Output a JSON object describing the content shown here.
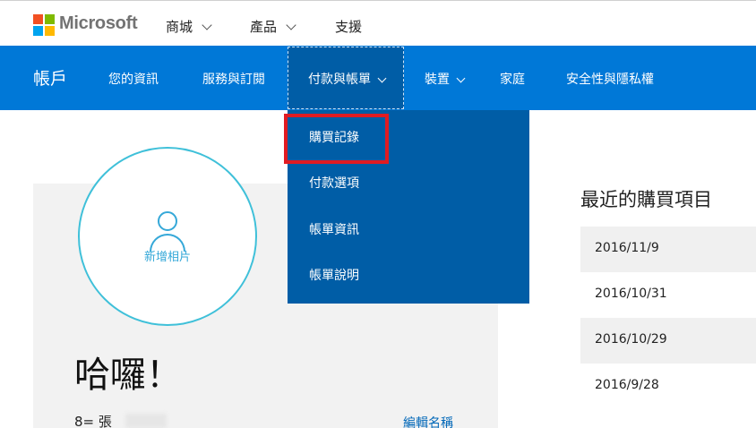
{
  "header": {
    "brand": "Microsoft",
    "nav": [
      {
        "label": "商城",
        "has_dropdown": true
      },
      {
        "label": "產品",
        "has_dropdown": true
      },
      {
        "label": "支援",
        "has_dropdown": false
      }
    ]
  },
  "account_nav": {
    "title": "帳戶",
    "items": [
      {
        "label": "您的資訊"
      },
      {
        "label": "服務與訂閱"
      },
      {
        "label": "付款與帳單",
        "active": true,
        "has_dropdown": true
      },
      {
        "label": "裝置",
        "has_dropdown": true
      },
      {
        "label": "家庭"
      },
      {
        "label": "安全性與隱私權"
      }
    ]
  },
  "dropdown": {
    "items": [
      {
        "label": "購買記錄",
        "highlighted": true
      },
      {
        "label": "付款選項"
      },
      {
        "label": "帳單資訊"
      },
      {
        "label": "帳單說明"
      }
    ]
  },
  "profile": {
    "add_photo": "新增相片",
    "greeting": "哈囉！",
    "name_prefix": "8= 張",
    "edit_name": "編輯名稱"
  },
  "recent": {
    "title": "最近的購買項目",
    "dates": [
      "2016/11/9",
      "2016/10/31",
      "2016/10/29",
      "2016/9/28"
    ]
  },
  "colors": {
    "accent_blue": "#0078d7",
    "dropdown_blue": "#005da6",
    "highlight_red": "#e11b22",
    "ring_teal": "#3fc0d9"
  }
}
